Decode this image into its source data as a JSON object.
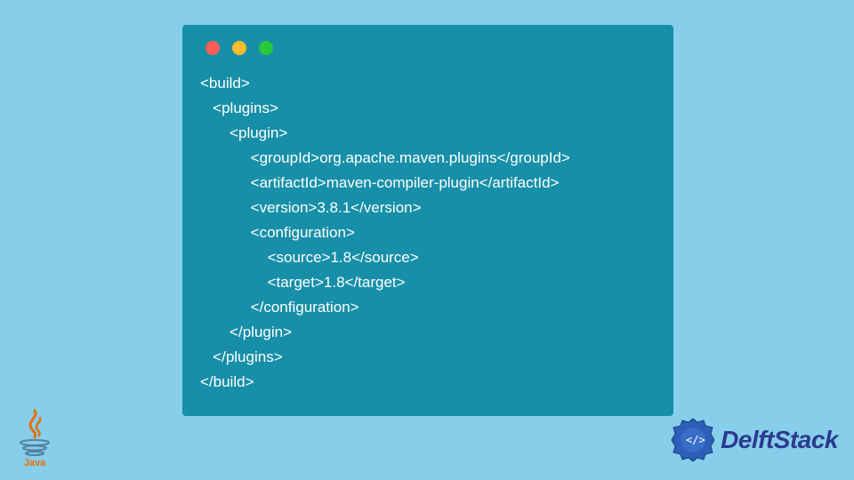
{
  "code": {
    "lines": [
      "<build>",
      "   <plugins>",
      "       <plugin>",
      "            <groupId>org.apache.maven.plugins</groupId>",
      "            <artifactId>maven-compiler-plugin</artifactId>",
      "            <version>3.8.1</version>",
      "            <configuration>",
      "                <source>1.8</source>",
      "                <target>1.8</target>",
      "            </configuration>",
      "       </plugin>",
      "   </plugins>",
      "</build>"
    ]
  },
  "logos": {
    "java": "Java",
    "delft": "DelftStack"
  },
  "colors": {
    "page_bg": "#87ceeb",
    "window_bg": "#178fa8",
    "code_text": "#ffffff",
    "red": "#ff5f56",
    "yellow": "#ffbd2e",
    "green": "#27c93f",
    "delft_blue": "#2b3a8f",
    "java_red": "#e76f00"
  }
}
